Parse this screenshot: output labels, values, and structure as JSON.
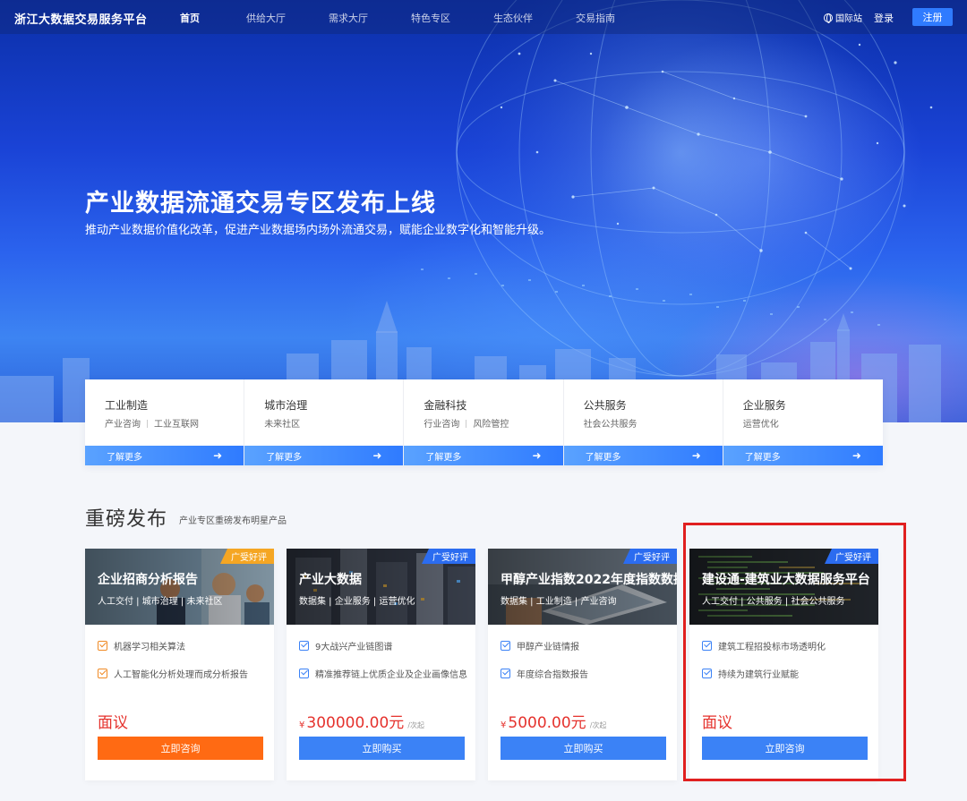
{
  "nav": {
    "brand": "浙江大数据交易服务平台",
    "items": [
      "首页",
      "供给大厅",
      "需求大厅",
      "特色专区",
      "生态伙伴",
      "交易指南"
    ],
    "global_site": "国际站",
    "login": "登录",
    "register": "注册"
  },
  "hero": {
    "title": "产业数据流通交易专区发布上线",
    "subtitle": "推动产业数据价值化改革，促进产业数据场内场外流通交易，赋能企业数字化和智能升级。"
  },
  "categories": [
    {
      "title": "工业制造",
      "subs": [
        "产业咨询",
        "工业互联网"
      ],
      "more": "了解更多"
    },
    {
      "title": "城市治理",
      "subs": [
        "未来社区"
      ],
      "more": "了解更多"
    },
    {
      "title": "金融科技",
      "subs": [
        "行业咨询",
        "风险管控"
      ],
      "more": "了解更多"
    },
    {
      "title": "公共服务",
      "subs": [
        "社会公共服务"
      ],
      "more": "了解更多"
    },
    {
      "title": "企业服务",
      "subs": [
        "运营优化"
      ],
      "more": "了解更多"
    }
  ],
  "section": {
    "title": "重磅发布",
    "subtitle": "产业专区重磅发布明星产品"
  },
  "products": [
    {
      "name": "企业招商分析报告",
      "tags": "人工交付 | 城市治理 | 未来社区",
      "badge": "广受好评",
      "badge_color": "#f5a623",
      "features": [
        "机器学习相关算法",
        "人工智能化分析处理而成分析报告"
      ],
      "check_color": "#f08a24",
      "price_yen": "",
      "price": "面议",
      "price_unit": "",
      "button": "立即咨询",
      "button_color": "#ff6a13"
    },
    {
      "name": "产业大数据",
      "tags": "数据集 | 企业服务 | 运营优化",
      "badge": "广受好评",
      "badge_color": "#2b6cf0",
      "features": [
        "9大战兴产业链图谱",
        "精准推荐链上优质企业及企业画像信息"
      ],
      "check_color": "#3b82f6",
      "price_yen": "¥",
      "price": "300000.00元",
      "price_unit": "/次起",
      "button": "立即购买",
      "button_color": "#3b82f6"
    },
    {
      "name": "甲醇产业指数2022年度指数数据",
      "tags": "数据集 | 工业制造 | 产业咨询",
      "badge": "广受好评",
      "badge_color": "#2b6cf0",
      "features": [
        "甲醇产业链情报",
        "年度综合指数报告"
      ],
      "check_color": "#3b82f6",
      "price_yen": "¥",
      "price": "5000.00元",
      "price_unit": "/次起",
      "button": "立即购买",
      "button_color": "#3b82f6"
    },
    {
      "name": "建设通-建筑业大数据服务平台",
      "tags": "人工交付 | 公共服务 | 社会公共服务",
      "badge": "广受好评",
      "badge_color": "#2b6cf0",
      "features": [
        "建筑工程招投标市场透明化",
        "持续为建筑行业赋能"
      ],
      "check_color": "#3b82f6",
      "price_yen": "",
      "price": "面议",
      "price_unit": "",
      "button": "立即咨询",
      "button_color": "#3b82f6"
    }
  ],
  "colors": {
    "accent_blue": "#2f7bff",
    "price_red": "#e5322d",
    "highlight_red": "#e02020"
  }
}
